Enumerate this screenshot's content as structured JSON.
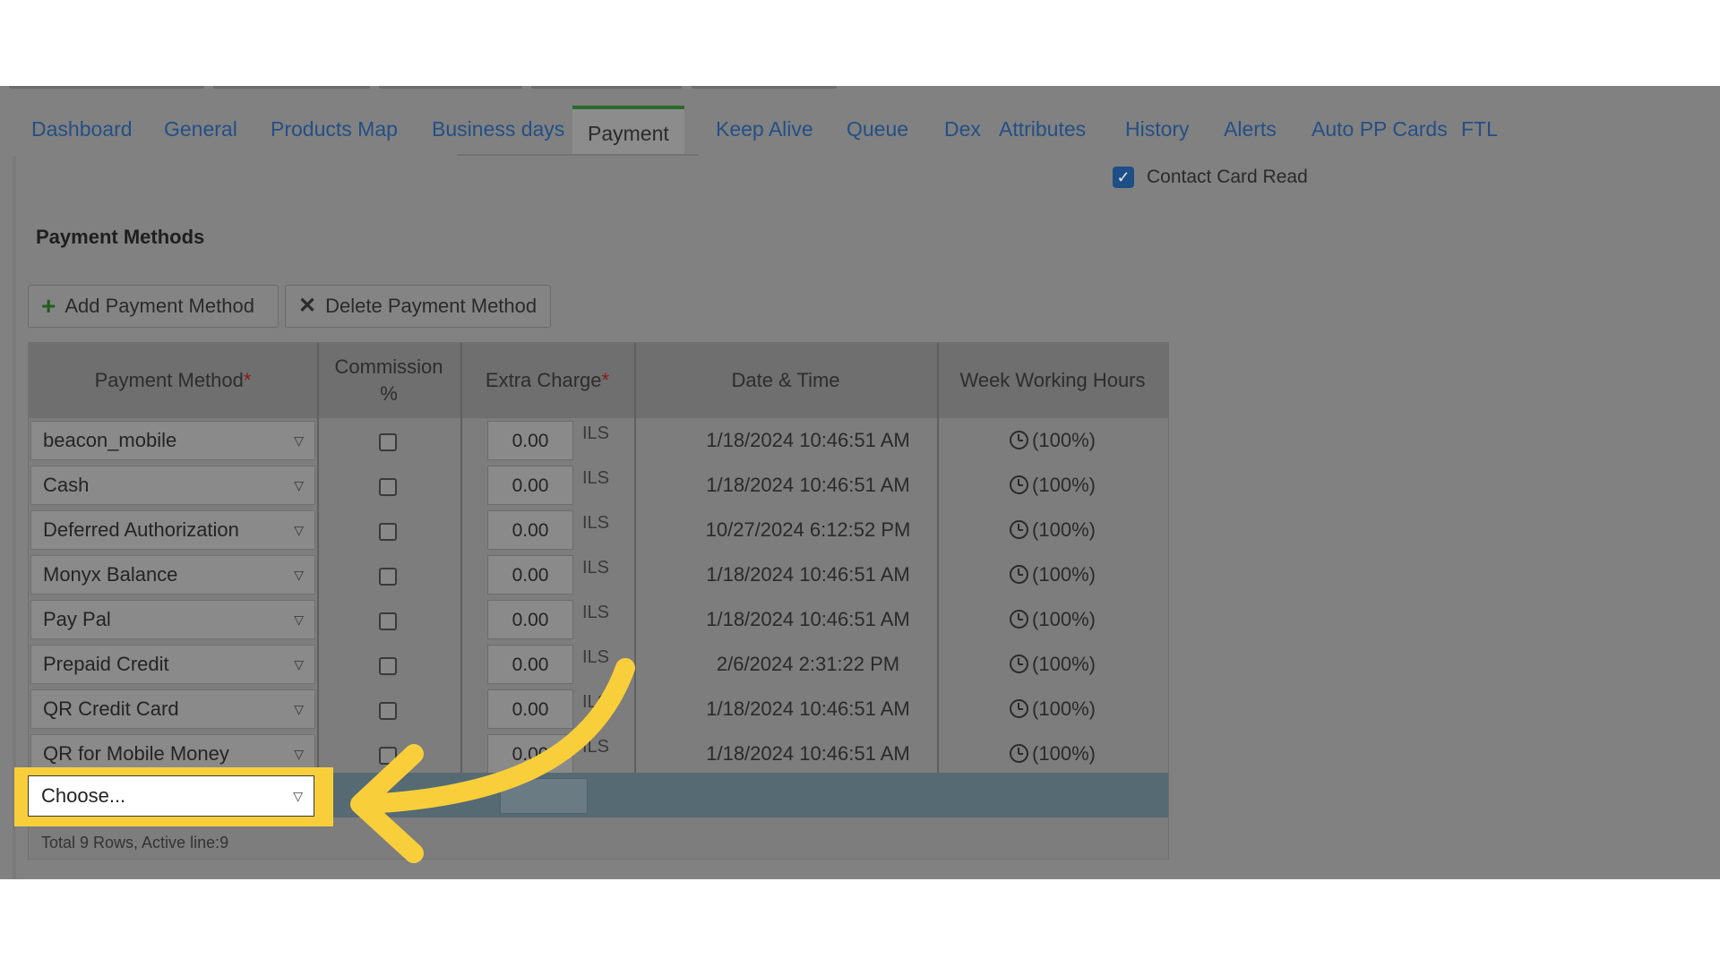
{
  "tabs": {
    "items": [
      {
        "label": "Dashboard"
      },
      {
        "label": "General"
      },
      {
        "label": "Products Map"
      },
      {
        "label": "Business days"
      },
      {
        "label": "Payment"
      },
      {
        "label": "Keep Alive"
      },
      {
        "label": "Queue"
      },
      {
        "label": "Dex"
      },
      {
        "label": "Attributes"
      },
      {
        "label": "History"
      },
      {
        "label": "Alerts"
      },
      {
        "label": "Auto PP Cards"
      },
      {
        "label": "FTL"
      }
    ],
    "active": "Payment"
  },
  "contact_card": {
    "label": "Contact Card Read",
    "checked": true
  },
  "section_title": "Payment Methods",
  "toolbar": {
    "add_label": "Add Payment Method",
    "delete_label": "Delete Payment Method",
    "add_icon": "plus-icon",
    "delete_icon": "x-icon"
  },
  "grid": {
    "headers": {
      "payment_method": "Payment Method",
      "commission_line1": "Commission",
      "commission_line2": "%",
      "extra_charge": "Extra Charge",
      "date_time": "Date & Time",
      "week_hours": "Week Working Hours",
      "required_mark": "*"
    },
    "currency": "ILS",
    "rows": [
      {
        "method": "beacon_mobile",
        "charge": "0.00",
        "datetime": "1/18/2024 10:46:51 AM",
        "hours": "(100%)"
      },
      {
        "method": "Cash",
        "charge": "0.00",
        "datetime": "1/18/2024 10:46:51 AM",
        "hours": "(100%)"
      },
      {
        "method": "Deferred Authorization",
        "charge": "0.00",
        "datetime": "10/27/2024 6:12:52 PM",
        "hours": "(100%)"
      },
      {
        "method": "Monyx Balance",
        "charge": "0.00",
        "datetime": "1/18/2024 10:46:51 AM",
        "hours": "(100%)"
      },
      {
        "method": "Pay Pal",
        "charge": "0.00",
        "datetime": "1/18/2024 10:46:51 AM",
        "hours": "(100%)"
      },
      {
        "method": "Prepaid Credit",
        "charge": "0.00",
        "datetime": "2/6/2024 2:31:22 PM",
        "hours": "(100%)"
      },
      {
        "method": "QR Credit Card",
        "charge": "0.00",
        "datetime": "1/18/2024 10:46:51 AM",
        "hours": "(100%)"
      },
      {
        "method": "QR for Mobile Money",
        "charge": "0.00",
        "datetime": "1/18/2024 10:46:51 AM",
        "hours": "(100%)"
      }
    ],
    "new_row": {
      "placeholder": "Choose..."
    },
    "footer": "Total 9 Rows, Active line:9"
  },
  "colors": {
    "highlight": "#f8cf3b",
    "accent_tab": "#2b6a2b",
    "link": "#234f86"
  }
}
